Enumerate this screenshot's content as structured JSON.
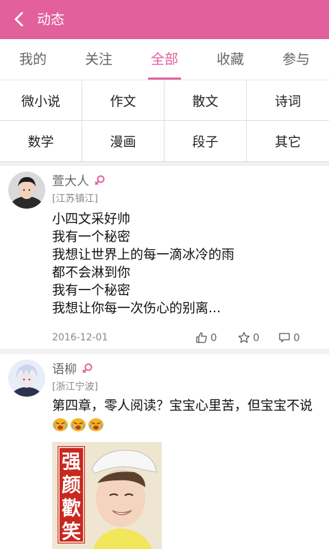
{
  "appbar": {
    "title": "动态",
    "back_icon": "back-arrow-icon"
  },
  "tabs": [
    {
      "label": "我的",
      "active": false
    },
    {
      "label": "关注",
      "active": false
    },
    {
      "label": "全部",
      "active": true
    },
    {
      "label": "收藏",
      "active": false
    },
    {
      "label": "参与",
      "active": false
    }
  ],
  "categories": [
    "微小说",
    "作文",
    "散文",
    "诗词",
    "数学",
    "漫画",
    "段子",
    "其它"
  ],
  "posts": [
    {
      "username": "萱大人",
      "gender_icon": "female-icon",
      "location": "[江苏镇江]",
      "lines": [
        "小四文采好帅",
        "我有一个秘密",
        "我想让世界上的每一滴冰冷的雨",
        "都不会淋到你",
        "我有一个秘密",
        "我想让你每一次伤心的别离..."
      ],
      "date": "2016-12-01",
      "likes": "0",
      "favorites": "0",
      "comments": "0"
    },
    {
      "username": "语柳",
      "gender_icon": "female-icon",
      "location": "[浙江宁波]",
      "text": "第四章，零人阅读？宝宝心里苦，但宝宝不说",
      "emoji_icon": "crying-face-icon",
      "image_caption": "强颜歡笑"
    }
  ],
  "colors": {
    "accent": "#e2609c",
    "divider": "#dcdcdc",
    "background_gap": "#f1f1f1"
  }
}
